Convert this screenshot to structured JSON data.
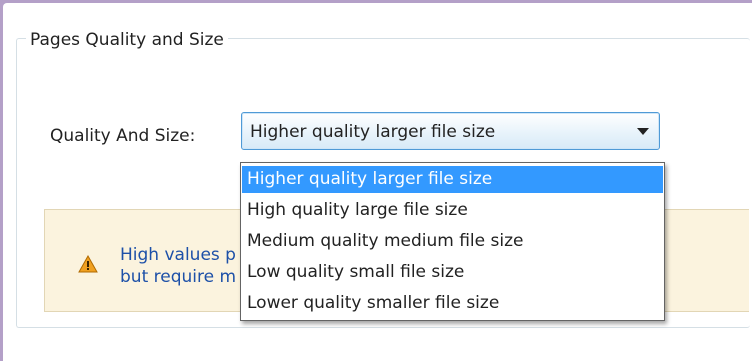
{
  "group": {
    "title": "Pages Quality and Size"
  },
  "quality": {
    "label": "Quality And Size:",
    "selected": "Higher quality larger file size",
    "options": [
      "Higher quality larger file size",
      "High quality large file size",
      "Medium quality medium file size",
      "Low quality small file size",
      "Lower quality smaller file size"
    ]
  },
  "warning": {
    "text_line1": "High values p",
    "text_line2": "but require m",
    "icon": "warning-icon"
  },
  "colors": {
    "selection": "#3399ff",
    "warning_bg": "#fbf3de",
    "warning_text": "#1d50a8",
    "window_frame": "#b4a0c8"
  }
}
